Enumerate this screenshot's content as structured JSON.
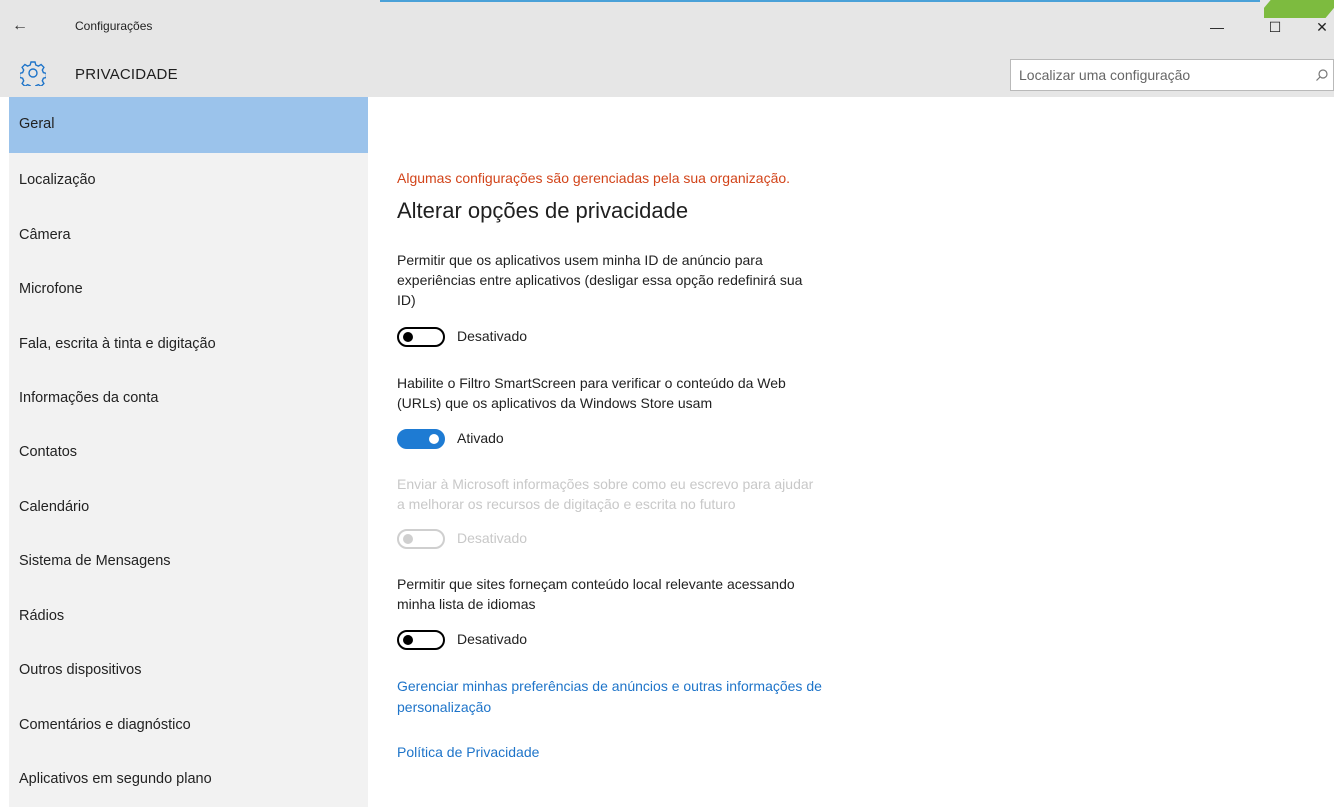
{
  "window": {
    "back_glyph": "←",
    "app_title": "Configurações",
    "min_glyph": "—",
    "max_glyph": "☐",
    "close_glyph": "✕"
  },
  "header": {
    "page_title": "PRIVACIDADE",
    "icon": "gear-icon",
    "search_placeholder": "Localizar uma configuração",
    "search_icon": "search-icon"
  },
  "sidebar": {
    "selected": "Geral",
    "items": [
      {
        "label": "Geral"
      },
      {
        "label": "Localização"
      },
      {
        "label": "Câmera"
      },
      {
        "label": "Microfone"
      },
      {
        "label": "Fala, escrita à tinta e digitação"
      },
      {
        "label": "Informações da conta"
      },
      {
        "label": "Contatos"
      },
      {
        "label": "Calendário"
      },
      {
        "label": "Sistema de Mensagens"
      },
      {
        "label": "Rádios"
      },
      {
        "label": "Outros dispositivos"
      },
      {
        "label": "Comentários e diagnóstico"
      },
      {
        "label": "Aplicativos em segundo plano"
      }
    ]
  },
  "main": {
    "warning": "Algumas configurações são gerenciadas pela sua organização.",
    "title": "Alterar opções de privacidade",
    "options": [
      {
        "text_lines": [
          "Permitir que os aplicativos usem minha ID de anúncio para",
          "experiências entre aplicativos (desligar essa opção redefinirá sua",
          "ID)"
        ],
        "state": "Desativado",
        "on": false,
        "enabled": true
      },
      {
        "text_lines": [
          "Habilite o Filtro SmartScreen para verificar o conteúdo da Web",
          "(URLs) que os aplicativos da Windows Store usam"
        ],
        "state": "Ativado",
        "on": true,
        "enabled": true
      },
      {
        "text_lines": [
          "Enviar à Microsoft informações sobre como eu escrevo para ajudar",
          "a melhorar os recursos de digitação e escrita no futuro"
        ],
        "state": "Desativado",
        "on": false,
        "enabled": false
      },
      {
        "text_lines": [
          "Permitir que sites forneçam conteúdo local relevante acessando",
          "minha lista de idiomas"
        ],
        "state": "Desativado",
        "on": false,
        "enabled": true
      }
    ],
    "links": [
      {
        "lines": [
          "Gerenciar minhas preferências de anúncios e outras informações de",
          "personalização"
        ]
      },
      {
        "lines": [
          "Política de Privacidade"
        ]
      }
    ]
  },
  "colors": {
    "accent": "#1e7bd3",
    "selected_nav": "#9bc3eb",
    "warning": "#d2441a",
    "link": "#1e74c9"
  }
}
